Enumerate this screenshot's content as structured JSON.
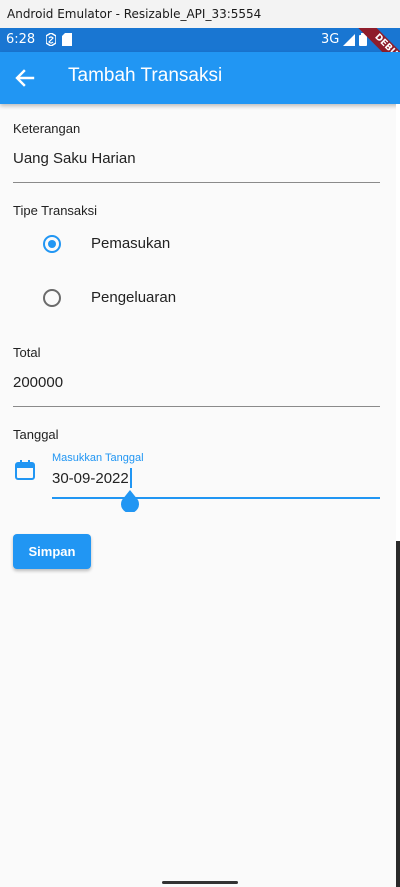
{
  "emulator": {
    "title": "Android Emulator - Resizable_API_33:5554"
  },
  "status_bar": {
    "time": "6:28",
    "network": "3G",
    "debug_banner": "DEBUG"
  },
  "app_bar": {
    "title": "Tambah Transaksi",
    "back_icon": "arrow-back-icon"
  },
  "form": {
    "keterangan": {
      "label": "Keterangan",
      "value": "Uang Saku Harian"
    },
    "tipe": {
      "label": "Tipe Transaksi",
      "options": [
        {
          "label": "Pemasukan",
          "selected": true
        },
        {
          "label": "Pengeluaran",
          "selected": false
        }
      ]
    },
    "total": {
      "label": "Total",
      "value": "200000"
    },
    "tanggal": {
      "label": "Tanggal",
      "floating_label": "Masukkan Tanggal",
      "value": "30-09-2022",
      "icon": "calendar-icon"
    },
    "save_label": "Simpan"
  },
  "colors": {
    "primary": "#2196f3",
    "status_bar": "#1976d2",
    "background": "#fafafa"
  }
}
